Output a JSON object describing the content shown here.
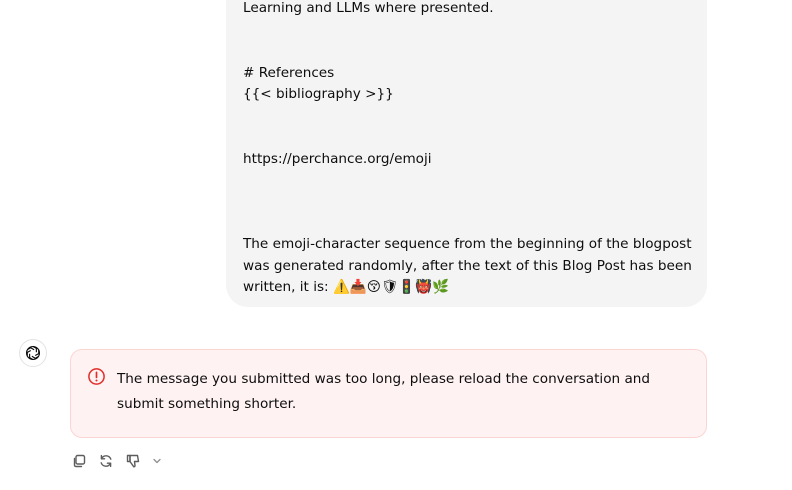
{
  "user_message": {
    "lines": [
      "Learning and LLMs where presented.",
      "# References",
      "{{< bibliography >}}",
      "https://perchance.org/emoji",
      "The emoji-character sequence from the beginning of the blogpost",
      "was generated randomly, after the text of this Blog Post has been",
      "written, it is: ⚠️📥😚🛡🚦👹🌿"
    ]
  },
  "assistant": {
    "avatar_icon": "openai-logo-icon"
  },
  "error": {
    "icon": "info-circle-icon",
    "message": "The message you submitted was too long, please reload the conversation and submit something shorter.",
    "accent_color": "#e02e2a"
  },
  "actions": {
    "copy_icon": "copy-icon",
    "regenerate_icon": "regenerate-icon",
    "dislike_icon": "thumbs-down-icon",
    "more_icon": "chevron-down-icon"
  }
}
